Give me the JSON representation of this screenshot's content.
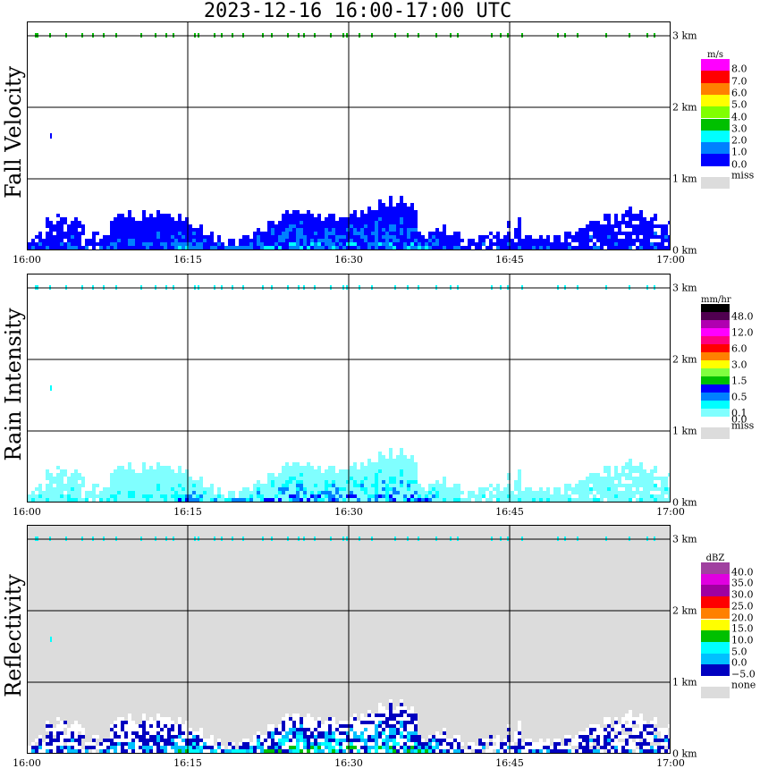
{
  "title": "2023-12-16  16:00-17:00 UTC",
  "chart_data": [
    {
      "type": "heatmap",
      "ylabel": "Fall Velocity",
      "x_ticks": [
        "16:00",
        "16:15",
        "16:30",
        "16:45",
        "17:00"
      ],
      "y_ticks": [
        "0 km",
        "1 km",
        "2 km",
        "3 km"
      ],
      "legend": {
        "unit": "m/s",
        "colors": [
          "#ff00ff",
          "#ff0000",
          "#ff8000",
          "#ffff00",
          "#80ff00",
          "#00c000",
          "#00ffff",
          "#0080ff",
          "#0000ff"
        ],
        "labels": [
          "8.0",
          "7.0",
          "6.0",
          "5.0",
          "4.0",
          "3.0",
          "2.0",
          "1.0",
          "0.0"
        ],
        "missing_label": "miss",
        "missing_color": "#dcdcdc"
      },
      "echo_colors": [
        "#0000ff",
        "#0000ff",
        "#0080ff",
        "#0080ff",
        "#00ffff"
      ],
      "top_color": "#00c000",
      "background": "#ffffff"
    },
    {
      "type": "heatmap",
      "ylabel": "Rain Intensity",
      "x_ticks": [
        "16:00",
        "16:15",
        "16:30",
        "16:45",
        "17:00"
      ],
      "y_ticks": [
        "0 km",
        "1 km",
        "2 km",
        "3 km"
      ],
      "legend": {
        "unit": "mm/hr",
        "colors": [
          "#000000",
          "#500050",
          "#b000b0",
          "#ff00ff",
          "#ff0080",
          "#ff0000",
          "#ff8000",
          "#ffff00",
          "#80ff40",
          "#00c000",
          "#0000ff",
          "#0080ff",
          "#00ffff",
          "#80ffff"
        ],
        "labels": [
          "48.0",
          "12.0",
          "6.0",
          "3.0",
          "1.5",
          "0.5",
          "0.1",
          "0.0"
        ],
        "missing_label": "miss",
        "missing_color": "#dcdcdc"
      },
      "echo_colors": [
        "#80ffff",
        "#80ffff",
        "#00ffff",
        "#0080ff",
        "#0000ff"
      ],
      "top_color": "#00ffff",
      "background": "#ffffff"
    },
    {
      "type": "heatmap",
      "ylabel": "Reflectivity",
      "x_ticks": [
        "16:00",
        "16:15",
        "16:30",
        "16:45",
        "17:00"
      ],
      "y_ticks": [
        "0 km",
        "1 km",
        "2 km",
        "3 km"
      ],
      "legend": {
        "unit": "dBZ",
        "colors": [
          "#a040a0",
          "#e000e0",
          "#a000a0",
          "#ff0000",
          "#ff8000",
          "#ffff00",
          "#00c000",
          "#00ffff",
          "#00c0ff",
          "#0000c0"
        ],
        "labels": [
          "40.0",
          "35.0",
          "30.0",
          "25.0",
          "20.0",
          "15.0",
          "10.0",
          "5.0",
          "0.0",
          "−5.0"
        ],
        "missing_label": "none",
        "missing_color": "#dcdcdc"
      },
      "echo_colors": [
        "#ffffff",
        "#0000c0",
        "#00c0ff",
        "#00ffff",
        "#00c000"
      ],
      "top_color": "#00ffff",
      "background": "#dcdcdc"
    }
  ]
}
